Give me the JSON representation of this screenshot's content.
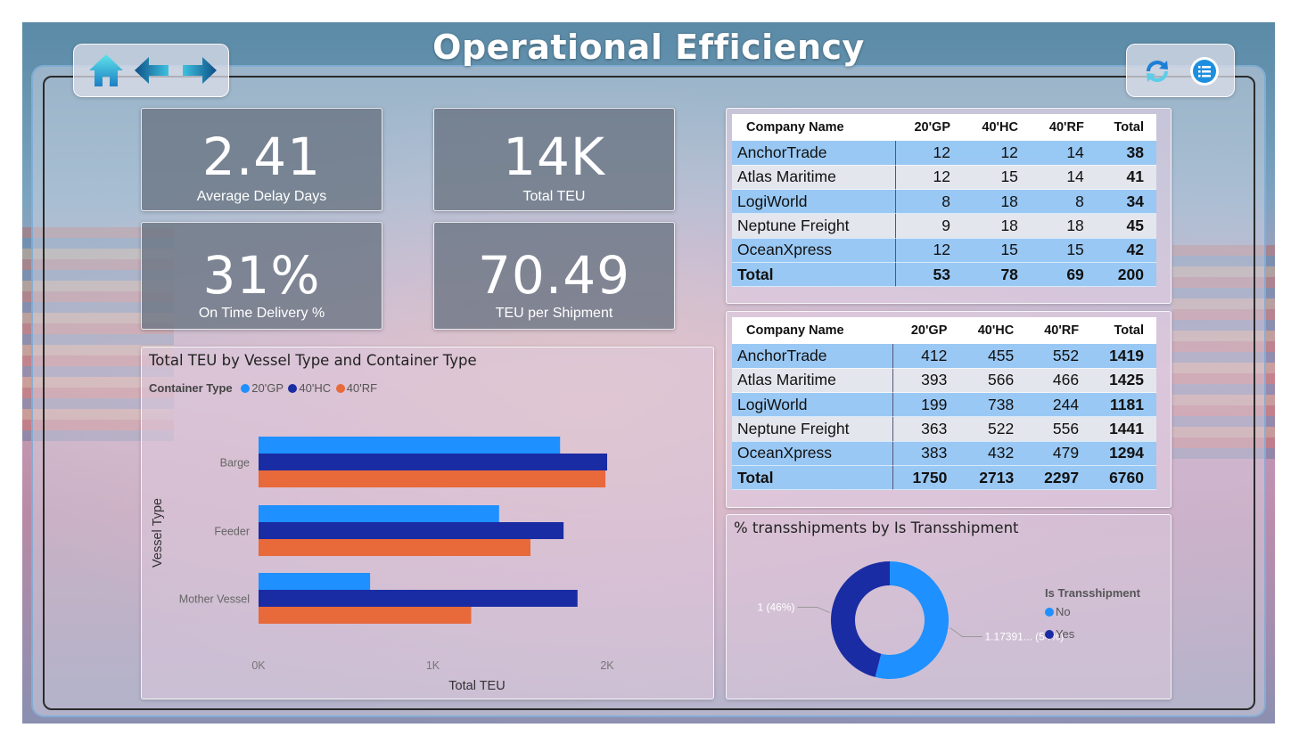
{
  "page": {
    "title": "Operational Efficiency"
  },
  "nav": {
    "home_icon": "home-icon",
    "back_icon": "arrow-left-icon",
    "forward_icon": "arrow-right-icon",
    "refresh_icon": "refresh-icon",
    "menu_icon": "list-menu-icon"
  },
  "kpis": [
    {
      "value": "2.41",
      "label": "Average Delay Days"
    },
    {
      "value": "14K",
      "label": "Total TEU"
    },
    {
      "value": "31%",
      "label": "On Time Delivery %"
    },
    {
      "value": "70.49",
      "label": "TEU per Shipment"
    }
  ],
  "table_counts": {
    "headers": [
      "Company Name",
      "20'GP",
      "40'HC",
      "40'RF",
      "Total"
    ],
    "rows": [
      [
        "AnchorTrade",
        "12",
        "12",
        "14",
        "38"
      ],
      [
        "Atlas Maritime",
        "12",
        "15",
        "14",
        "41"
      ],
      [
        "LogiWorld",
        "8",
        "18",
        "8",
        "34"
      ],
      [
        "Neptune Freight",
        "9",
        "18",
        "18",
        "45"
      ],
      [
        "OceanXpress",
        "12",
        "15",
        "15",
        "42"
      ]
    ],
    "total": [
      "Total",
      "53",
      "78",
      "69",
      "200"
    ]
  },
  "table_teu": {
    "headers": [
      "Company Name",
      "20'GP",
      "40'HC",
      "40'RF",
      "Total"
    ],
    "rows": [
      [
        "AnchorTrade",
        "412",
        "455",
        "552",
        "1419"
      ],
      [
        "Atlas Maritime",
        "393",
        "566",
        "466",
        "1425"
      ],
      [
        "LogiWorld",
        "199",
        "738",
        "244",
        "1181"
      ],
      [
        "Neptune Freight",
        "363",
        "522",
        "556",
        "1441"
      ],
      [
        "OceanXpress",
        "383",
        "432",
        "479",
        "1294"
      ]
    ],
    "total": [
      "Total",
      "1750",
      "2713",
      "2297",
      "6760"
    ]
  },
  "chart_data": [
    {
      "type": "bar",
      "orientation": "horizontal",
      "title": "Total TEU by Vessel Type and Container Type",
      "legend_title": "Container Type",
      "legend_position": "top-left",
      "categories": [
        "Barge",
        "Feeder",
        "Mother Vessel"
      ],
      "series": [
        {
          "name": "20'GP",
          "color": "#1E90FF",
          "values": [
            1730,
            1380,
            640
          ]
        },
        {
          "name": "40'HC",
          "color": "#1A2CA3",
          "values": [
            2000,
            1750,
            1830
          ]
        },
        {
          "name": "40'RF",
          "color": "#E8693A",
          "values": [
            1990,
            1560,
            1220
          ]
        }
      ],
      "xlabel": "Total TEU",
      "ylabel": "Vessel Type",
      "xlim": [
        0,
        2000
      ],
      "xticks": [
        "0K",
        "1K",
        "2K"
      ],
      "grid": false
    },
    {
      "type": "pie",
      "donut": true,
      "title": "% transshipments by Is Transshipment",
      "legend_title": "Is Transshipment",
      "legend_position": "right",
      "slices": [
        {
          "name": "No",
          "value": 1.17391,
          "percent": 54,
          "label": "1.17391... (54%)",
          "color": "#1E90FF"
        },
        {
          "name": "Yes",
          "value": 1,
          "percent": 46,
          "label": "1 (46%)",
          "color": "#1A2CA3"
        }
      ]
    }
  ]
}
